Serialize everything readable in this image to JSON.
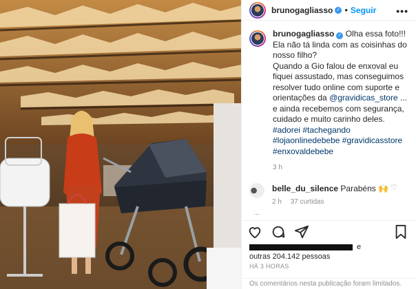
{
  "post": {
    "username": "brunogagliasso",
    "follow_label": "Seguir",
    "separator": "•",
    "more_label": "•••",
    "caption": {
      "intro": "Olha essa foto!!! Ela não tá linda com as coisinhas do nosso filho?",
      "body_1": "Quando a Gio falou de enxoval eu fiquei assustado, mas conseguimos resolver tudo online com suporte e orientações da",
      "mention": "@gravidicas_store",
      "body_2": "... e ainda recebemos com segurança, cuidado e muito carinho deles.",
      "hashtags": [
        "#adorei",
        "#tachegando",
        "#lojaonlinedebebe",
        "#gravidicasstore",
        "#enxovaldebebe"
      ],
      "age": "3 h"
    },
    "comment": {
      "username": "belle_du_silence",
      "text": "Parabéns 🙌",
      "age": "2 h",
      "likes": "37 curtidas"
    },
    "likes": {
      "suffix_e": "e",
      "others": "outras 204.142 pessoas"
    },
    "timestamp": "HÁ 3 HORAS",
    "footer_text": "Os comentários nesta publicação foram limitados."
  },
  "icons": {
    "like": "heart-icon",
    "comment": "comment-icon",
    "share": "share-icon",
    "save": "bookmark-icon",
    "more": "more-options-icon",
    "verified": "verified-badge-icon"
  },
  "colors": {
    "accent": "#0095f6",
    "link": "#00376b",
    "muted": "#8e8e8e",
    "verified": "#3897f0"
  }
}
